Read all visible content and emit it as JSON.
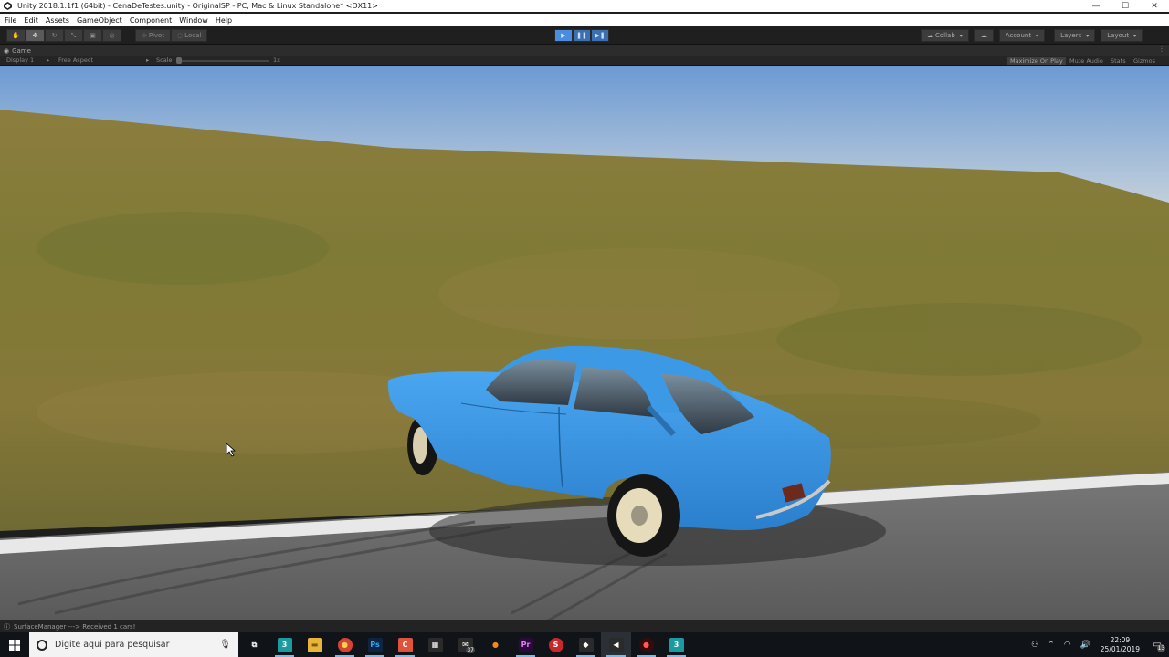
{
  "window": {
    "title": "Unity 2018.1.1f1 (64bit) - CenaDeTestes.unity - OriginalSP - PC, Mac & Linux Standalone* <DX11>",
    "controls": {
      "minimize": "—",
      "maximize": "☐",
      "close": "✕"
    }
  },
  "menu": [
    "File",
    "Edit",
    "Assets",
    "GameObject",
    "Component",
    "Window",
    "Help"
  ],
  "toolbar": {
    "pivot_label": "Pivot",
    "local_label": "Local",
    "collab_label": "Collab",
    "account_label": "Account",
    "layers_label": "Layers",
    "layout_label": "Layout"
  },
  "game_view": {
    "tab_label": "Game",
    "display_label": "Display 1",
    "aspect_label": "Free Aspect",
    "scale_label": "Scale",
    "scale_value": "1x",
    "toggles": [
      "Maximize On Play",
      "Mute Audio",
      "Stats",
      "Gizmos"
    ]
  },
  "status": {
    "message": "SurfaceManager ---> Received 1 cars!"
  },
  "taskbar": {
    "search_placeholder": "Digite aqui para pesquisar",
    "apps": [
      {
        "name": "task-view",
        "glyph": "⧉",
        "color": "#101418"
      },
      {
        "name": "3dsmax",
        "glyph": "3",
        "color": "#1b9aa0"
      },
      {
        "name": "file-explorer",
        "glyph": "▬",
        "color": "#e8b53a"
      },
      {
        "name": "chrome",
        "glyph": "●",
        "color": "#d64234"
      },
      {
        "name": "photoshop",
        "glyph": "Ps",
        "color": "#0f2440"
      },
      {
        "name": "app-c",
        "glyph": "C",
        "color": "#e0533a"
      },
      {
        "name": "calculator",
        "glyph": "▦",
        "color": "#2a2a2a"
      },
      {
        "name": "mail",
        "glyph": "✉",
        "color": "#2a2a2a"
      },
      {
        "name": "blender",
        "glyph": "●",
        "color": "#f08a1c"
      },
      {
        "name": "premiere",
        "glyph": "Pr",
        "color": "#2a0a3a"
      },
      {
        "name": "substance",
        "glyph": "S",
        "color": "#c8282c"
      },
      {
        "name": "unity-hub",
        "glyph": "◆",
        "color": "#2a2a2a"
      },
      {
        "name": "unity",
        "glyph": "◀",
        "color": "#2a2a2a"
      },
      {
        "name": "davinci",
        "glyph": "●",
        "color": "#3a0a0a"
      },
      {
        "name": "3dsmax-2",
        "glyph": "3",
        "color": "#1b9aa0"
      }
    ],
    "mail_badge": "37",
    "clock_time": "22:09",
    "clock_date": "25/01/2019",
    "notification_count": "13"
  },
  "colors": {
    "sky_top": "#6f9fd4",
    "sky_bottom": "#c9d4dd",
    "grass": "#8a7a3a",
    "road": "#6a6a6a",
    "car": "#3b96e0"
  }
}
